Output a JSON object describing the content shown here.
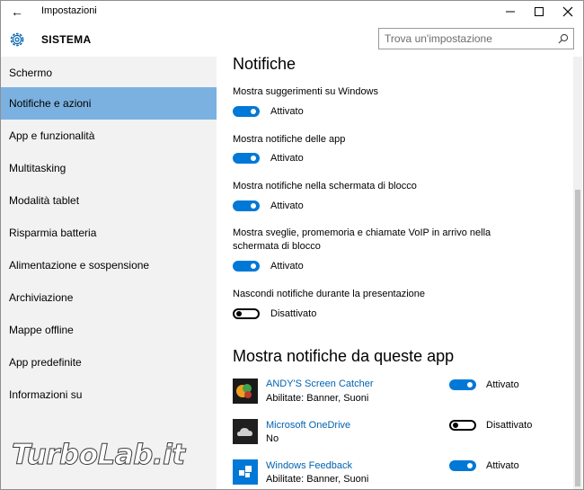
{
  "window": {
    "title": "Impostazioni",
    "back_glyph": "←",
    "minimize_glyph": "—",
    "maximize_glyph": "☐",
    "close_glyph": "✕"
  },
  "header": {
    "section": "SISTEMA",
    "icon": "gear-icon",
    "search_placeholder": "Trova un'impostazione"
  },
  "sidebar": {
    "items": [
      {
        "label": "Schermo",
        "active": false
      },
      {
        "label": "Notifiche e azioni",
        "active": true
      },
      {
        "label": "App e funzionalità",
        "active": false
      },
      {
        "label": "Multitasking",
        "active": false
      },
      {
        "label": "Modalità tablet",
        "active": false
      },
      {
        "label": "Risparmia batteria",
        "active": false
      },
      {
        "label": "Alimentazione e sospensione",
        "active": false
      },
      {
        "label": "Archiviazione",
        "active": false
      },
      {
        "label": "Mappe offline",
        "active": false
      },
      {
        "label": "App predefinite",
        "active": false
      },
      {
        "label": "Informazioni su",
        "active": false
      }
    ]
  },
  "main": {
    "notifications_heading": "Notifiche",
    "options": [
      {
        "label": "Mostra suggerimenti su Windows",
        "on": true,
        "state": "Attivato"
      },
      {
        "label": "Mostra notifiche delle app",
        "on": true,
        "state": "Attivato"
      },
      {
        "label": "Mostra notifiche nella schermata di blocco",
        "on": true,
        "state": "Attivato"
      },
      {
        "label": "Mostra sveglie, promemoria e chiamate VoIP in arrivo nella schermata di blocco",
        "on": true,
        "state": "Attivato"
      },
      {
        "label": "Nascondi notifiche durante la presentazione",
        "on": false,
        "state": "Disattivato"
      }
    ],
    "apps_heading": "Mostra notifiche da queste app",
    "apps": [
      {
        "name": "ANDY'S Screen Catcher",
        "sub": "Abilitate: Banner, Suoni",
        "on": true,
        "state": "Attivato"
      },
      {
        "name": "Microsoft OneDrive",
        "sub": "No",
        "on": false,
        "state": "Disattivato"
      },
      {
        "name": "Windows Feedback",
        "sub": "Abilitate: Banner, Suoni",
        "on": true,
        "state": "Attivato"
      }
    ]
  },
  "colors": {
    "accent": "#0078d7",
    "sidebar_bg": "#f2f2f2",
    "selected_bg": "#7bb1e0",
    "link": "#0063b1"
  },
  "watermark": "TurboLab.it"
}
